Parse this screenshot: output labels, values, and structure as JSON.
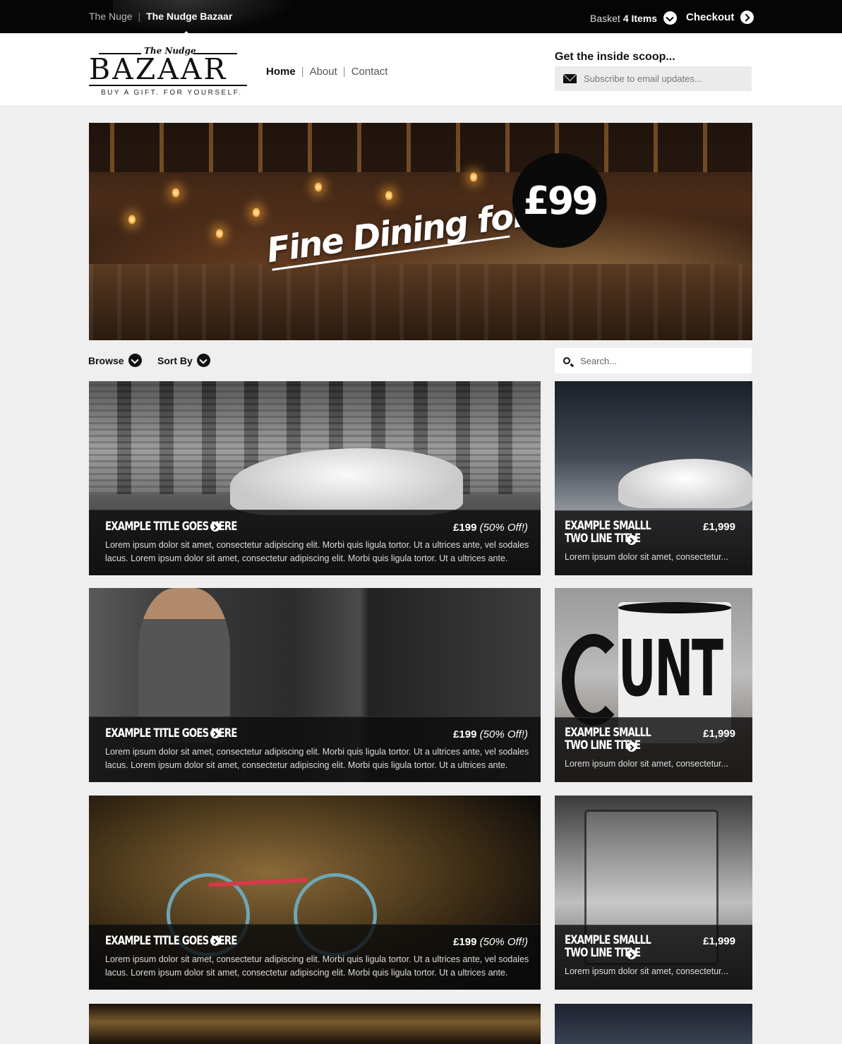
{
  "topbar": {
    "crumb_parent": "The Nuge",
    "crumb_current": "The Nudge Bazaar",
    "basket_label": "Basket",
    "basket_count": "4 Items",
    "checkout_label": "Checkout"
  },
  "header": {
    "logo_script": "The Nudge",
    "logo_name": "BAZAAR",
    "logo_tagline": "BUY A GIFT.  FOR YOURSELF.",
    "nav": [
      "Home",
      "About",
      "Contact"
    ],
    "scoop_heading": "Get the inside scoop...",
    "subscribe_placeholder": "Subscribe to email updates..."
  },
  "hero": {
    "title": "Fine Dining for Two",
    "price": "£99"
  },
  "filters": {
    "browse_label": "Browse",
    "sort_label": "Sort By",
    "search_placeholder": "Search..."
  },
  "products_large": [
    {
      "title": "Example Title Goes Here",
      "price": "£199",
      "discount": "(50% Off!)",
      "desc": "Lorem ipsum dolor sit amet, consectetur adipiscing elit. Morbi quis ligula tortor. Ut a ultrices ante, vel sodales lacus. Lorem ipsum dolor sit amet, consectetur adipiscing elit. Morbi quis ligula tortor. Ut a ultrices ante."
    },
    {
      "title": "Example Title Goes Here",
      "price": "£199",
      "discount": "(50% Off!)",
      "desc": "Lorem ipsum dolor sit amet, consectetur adipiscing elit. Morbi quis ligula tortor. Ut a ultrices ante, vel sodales lacus. Lorem ipsum dolor sit amet, consectetur adipiscing elit. Morbi quis ligula tortor. Ut a ultrices ante."
    },
    {
      "title": "Example Title Goes Here",
      "price": "£199",
      "discount": "(50% Off!)",
      "desc": "Lorem ipsum dolor sit amet, consectetur adipiscing elit. Morbi quis ligula tortor. Ut a ultrices ante, vel sodales lacus. Lorem ipsum dolor sit amet, consectetur adipiscing elit. Morbi quis ligula tortor. Ut a ultrices ante."
    }
  ],
  "products_small": [
    {
      "title_line1": "Example Smalll",
      "title_line2": "Two Line Title",
      "price": "£1,999",
      "desc": "Lorem ipsum dolor sit amet, consectetur..."
    },
    {
      "title_line1": "Example Smalll",
      "title_line2": "Two Line Title",
      "price": "£1,999",
      "desc": "Lorem ipsum dolor sit amet, consectetur..."
    },
    {
      "title_line1": "Example Smalll",
      "title_line2": "Two Line Title",
      "price": "£1,999",
      "desc": "Lorem ipsum dolor sit amet, consectetur..."
    }
  ],
  "images": {
    "mug_text": "UNT"
  },
  "colors": {
    "topbar": "#050505",
    "page_bg": "#efefef",
    "overlay": "#0c0c0c"
  }
}
